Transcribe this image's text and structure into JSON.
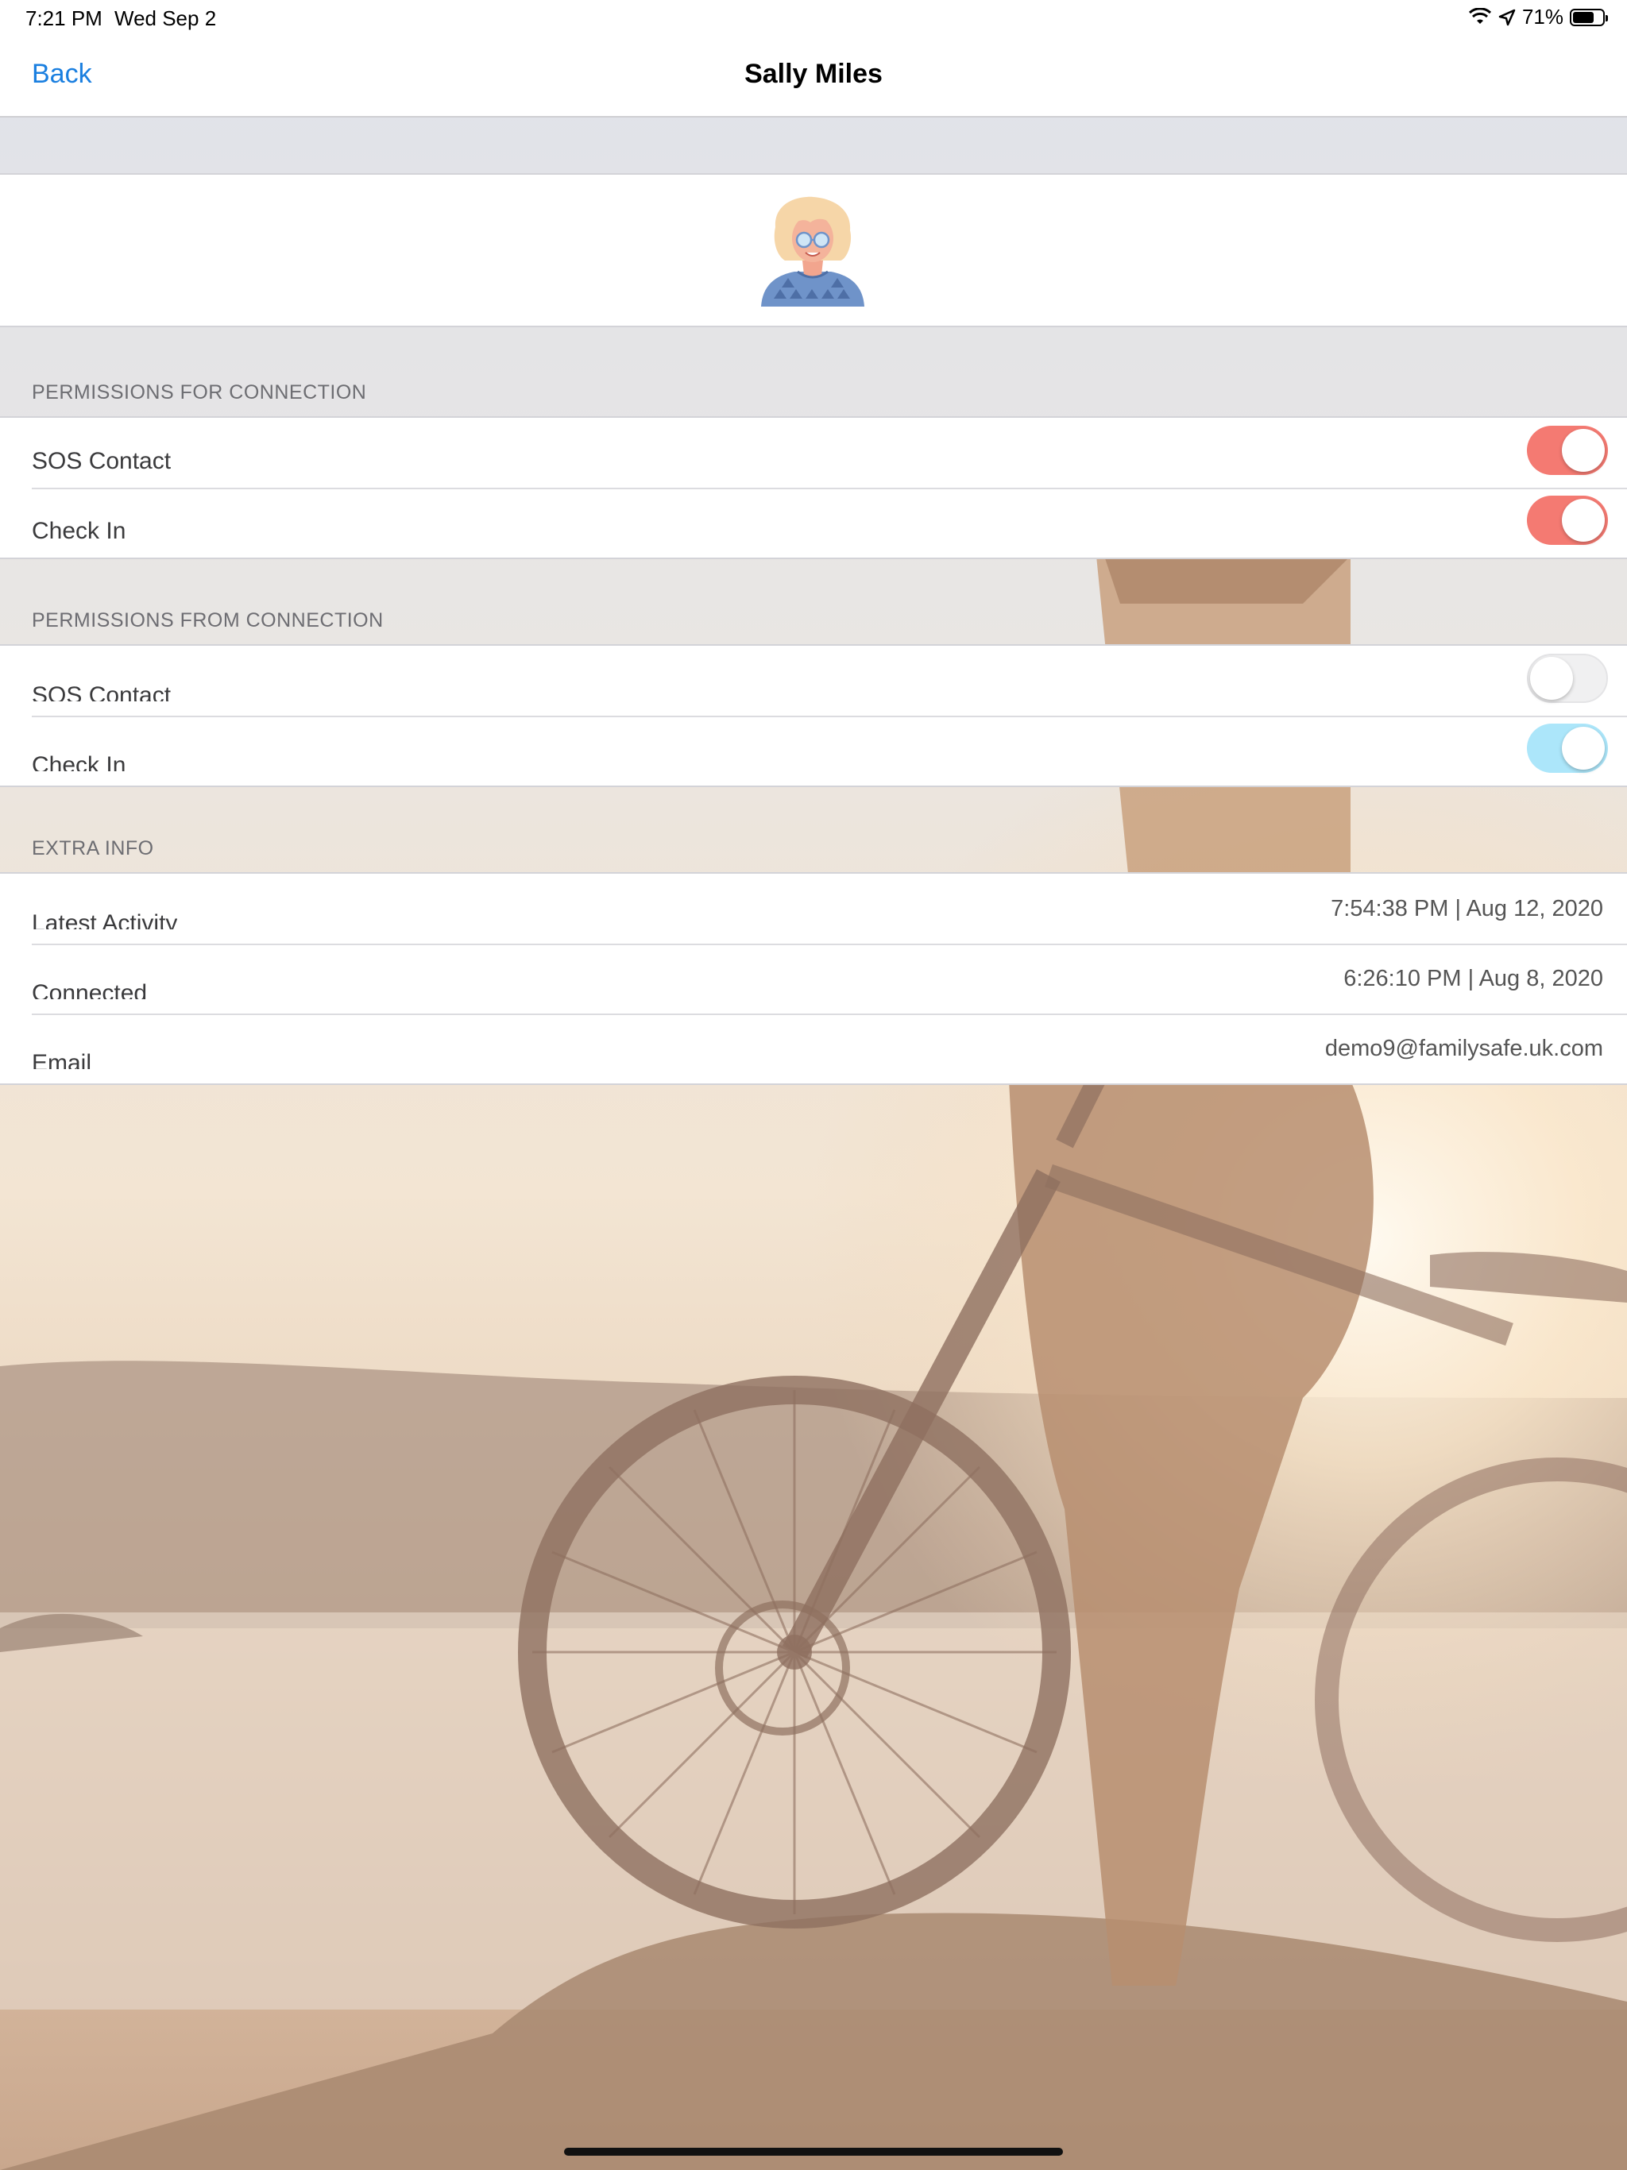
{
  "status_bar": {
    "time": "7:21 PM",
    "date": "Wed Sep 2",
    "battery": "71%",
    "battery_level": 0.71
  },
  "nav": {
    "back_label": "Back",
    "title": "Sally Miles"
  },
  "permissions_for": {
    "header": "PERMISSIONS FOR CONNECTION",
    "items": [
      {
        "label": "SOS Contact",
        "enabled": true
      },
      {
        "label": "Check In",
        "enabled": true
      }
    ]
  },
  "permissions_from": {
    "header": "PERMISSIONS FROM CONNECTION",
    "items": [
      {
        "label": "SOS Contact",
        "enabled": false
      },
      {
        "label": "Check In",
        "enabled": true
      }
    ]
  },
  "extra_info": {
    "header": "EXTRA INFO",
    "items": [
      {
        "label": "Latest Activity",
        "value": "7:54:38 PM | Aug 12, 2020"
      },
      {
        "label": "Connected",
        "value": "6:26:10 PM | Aug 8, 2020"
      },
      {
        "label": "Email",
        "value": "demo9@familysafe.uk.com"
      }
    ]
  },
  "colors": {
    "accent_blue": "#1a7fe0",
    "toggle_red": "#f47a72",
    "toggle_blue": "#ace6fa"
  },
  "icons": [
    "wifi-icon",
    "location-arrow-icon",
    "battery-icon",
    "avatar"
  ]
}
